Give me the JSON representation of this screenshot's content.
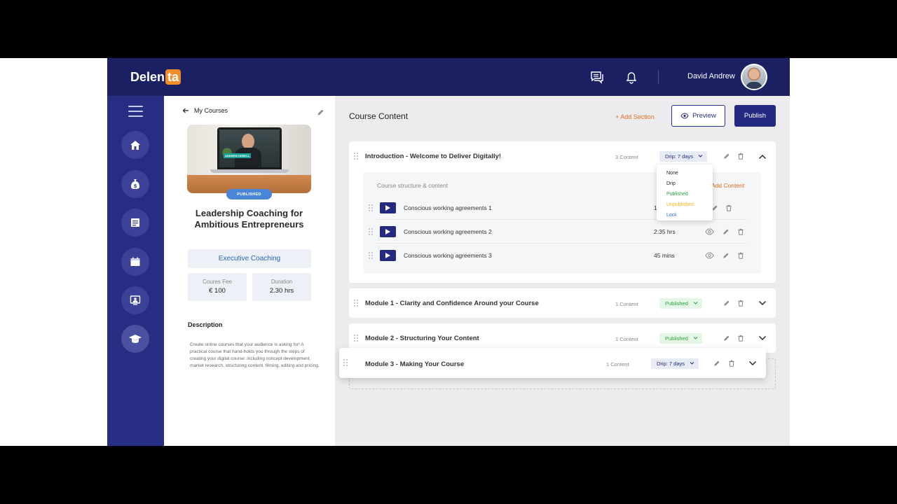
{
  "app": {
    "logo_left": "Delen",
    "logo_right": "ta"
  },
  "header": {
    "user_name": "David Andrew"
  },
  "course": {
    "back_label": "My Courses",
    "status_badge": "PUBLISHED",
    "thumb_label": "ANDREW DEBELL",
    "title": "Leadership Coaching for Ambitious Entrepreneurs",
    "category": "Executive Coaching",
    "fee_label": "Coures Fee",
    "fee_value": "€ 100",
    "duration_label": "Duration",
    "duration_value": "2.30 hrs",
    "description_heading": "Description",
    "description": "Create online courses that your audience is asking for! A practical course that hand-holds you through the steps of creating your digital course: including concept development, market research, structuring content, filming, editing and pricing."
  },
  "main": {
    "title": "Course Content",
    "add_section": "+ Add Section",
    "preview": "Preview",
    "publish": "Publish"
  },
  "sections": [
    {
      "title": "Introduction - Welcome to Deliver Digitally!",
      "count": "3 Content",
      "status": "Drip: 7 days"
    },
    {
      "title": "Module 1 - Clarity and Confidence Around your Course",
      "count": "1 Content",
      "status": "Published"
    },
    {
      "title": "Module 2 - Structuring Your Content",
      "count": "1 Content",
      "status": "Published"
    },
    {
      "title": "Module 3 - Making Your Course",
      "count": "1 Content",
      "status": "Drip: 7 days"
    }
  ],
  "structure": {
    "title": "Course structure & content",
    "add_content": "Add Content",
    "rows": [
      {
        "title": "Conscious working agreements 1",
        "duration": "1"
      },
      {
        "title": "Conscious working agreements 2",
        "duration": "2:35 hrs"
      },
      {
        "title": "Conscious working agreements 3",
        "duration": "45 mins"
      }
    ]
  },
  "dropdown": {
    "options": [
      {
        "label": "None",
        "color": "#222222"
      },
      {
        "label": "Drip",
        "color": "#222222"
      },
      {
        "label": "Published",
        "color": "#2aa33b"
      },
      {
        "label": "Unpublished",
        "color": "#f2b21b"
      },
      {
        "label": "Lock",
        "color": "#2a6fd1"
      }
    ]
  },
  "colors": {
    "navy": "#1b2062",
    "sidebar": "#262d82",
    "accent": "#f28c28",
    "orange_link": "#e56c1d"
  }
}
